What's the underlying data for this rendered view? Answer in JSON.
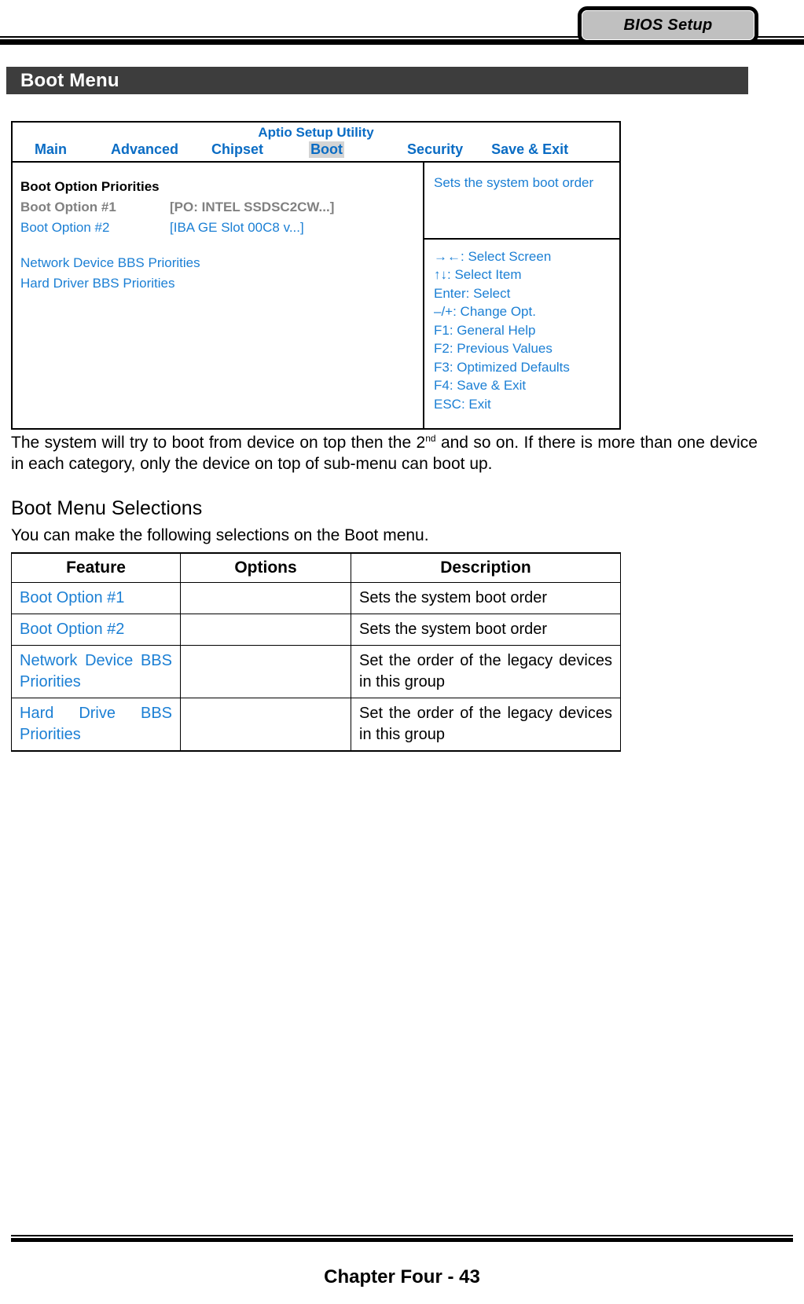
{
  "header": {
    "tab_label": "BIOS Setup"
  },
  "section": {
    "title": "Boot Menu"
  },
  "bios": {
    "utility_title": "Aptio Setup Utility",
    "tabs": [
      {
        "label": "Main",
        "selected": false
      },
      {
        "label": "Advanced",
        "selected": false
      },
      {
        "label": "Chipset",
        "selected": false
      },
      {
        "label": "Boot",
        "selected": true
      },
      {
        "label": "Security",
        "selected": false
      },
      {
        "label": "Save & Exit",
        "selected": false
      }
    ],
    "left_panel": {
      "heading": "Boot Option Priorities",
      "options": [
        {
          "label": "Boot Option #1",
          "value": "[PO: INTEL SSDSC2CW...]",
          "state": "disabled"
        },
        {
          "label": "Boot Option #2",
          "value": "[IBA GE Slot 00C8 v...]",
          "state": "active"
        }
      ],
      "links": [
        "Network Device BBS Priorities",
        "Hard Driver BBS Priorities"
      ]
    },
    "help": {
      "description": "Sets the system boot order",
      "keys": [
        "→←: Select Screen",
        "↑↓: Select Item",
        "Enter: Select",
        "–/+: Change Opt.",
        "F1: General Help",
        "F2: Previous Values",
        "F3: Optimized Defaults",
        "F4: Save & Exit",
        "ESC: Exit"
      ]
    }
  },
  "body": {
    "paragraph_part1": "The system will try to boot from device on top then the 2",
    "paragraph_sup": "nd",
    "paragraph_part2": " and so on. If there is more than one device in each category, only the device on top of sub-menu can boot up.",
    "subheading": "Boot Menu Selections",
    "subparagraph": "You can make the following selections on the Boot menu."
  },
  "feature_table": {
    "columns": [
      "Feature",
      "Options",
      "Description"
    ],
    "rows": [
      {
        "feature": "Boot Option #1",
        "options": "",
        "description": "Sets the system boot order"
      },
      {
        "feature": "Boot Option #2",
        "options": "",
        "description": "Sets the system boot order"
      },
      {
        "feature": "Network Device BBS Priorities",
        "options": "",
        "description": "Set the order of the legacy devices in this group"
      },
      {
        "feature": "Hard Drive BBS Priorities",
        "options": "",
        "description": "Set the order of the legacy devices in this group"
      }
    ]
  },
  "footer": {
    "text": "Chapter Four - 43"
  },
  "colors": {
    "accent_blue": "#1b7fd4",
    "title_blue": "#0a6cc4",
    "disabled_gray": "#808080",
    "bar_dark": "#3d3d3d",
    "tab_gray": "#c0c0c0",
    "highlight_gray": "#d4d4d4"
  }
}
